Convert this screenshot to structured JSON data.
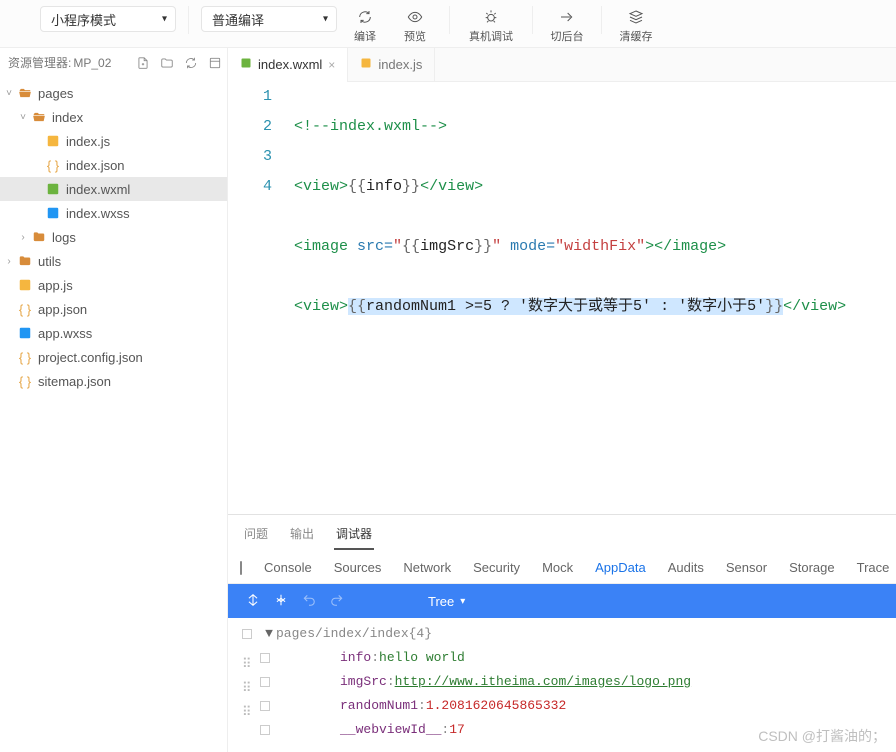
{
  "toolbar": {
    "mode_select": "小程序模式",
    "compile_select": "普通编译",
    "buttons": {
      "compile": "编译",
      "preview": "预览",
      "remote_debug": "真机调试",
      "cut_background": "切后台",
      "clear_cache": "清缓存"
    }
  },
  "sidebar": {
    "title_prefix": "资源管理器: ",
    "project_name": "MP_02",
    "nodes": {
      "pages": "pages",
      "index_folder": "index",
      "index_js": "index.js",
      "index_json": "index.json",
      "index_wxml": "index.wxml",
      "index_wxss": "index.wxss",
      "logs": "logs",
      "utils": "utils",
      "app_js": "app.js",
      "app_json": "app.json",
      "app_wxss": "app.wxss",
      "project_config": "project.config.json",
      "sitemap": "sitemap.json"
    }
  },
  "tabs": {
    "t0": "index.wxml",
    "t1": "index.js"
  },
  "code": {
    "line_numbers": [
      "1",
      "2",
      "3",
      "4"
    ],
    "l1_comment": "<!--index.wxml-->",
    "l2_open": "<view>",
    "l2_open_brace": "{{",
    "l2_expr": "info",
    "l2_close_brace": "}}",
    "l2_close": "</view>",
    "l3_open_tag": "<image",
    "l3_attr_src": " src=",
    "l3_src_q1": "\"",
    "l3_src_ob": "{{",
    "l3_src_expr": "imgSrc",
    "l3_src_cb": "}}",
    "l3_src_q2": "\"",
    "l3_attr_mode": " mode=",
    "l3_mode_val": "\"widthFix\"",
    "l3_close1": ">",
    "l3_close2": "</image>",
    "l4_open": "<view>",
    "l4_ob": "{{",
    "l4_expr": "randomNum1 >=5 ? '数字大于或等于5' : '数字小于5'",
    "l4_cb": "}}",
    "l4_close": "</view>"
  },
  "bottom": {
    "tabs": {
      "problems": "问题",
      "output": "输出",
      "debug": "调试器"
    },
    "devtabs": {
      "console": "Console",
      "sources": "Sources",
      "network": "Network",
      "security": "Security",
      "mock": "Mock",
      "appdata": "AppData",
      "audits": "Audits",
      "sensor": "Sensor",
      "storage": "Storage",
      "trace": "Trace"
    },
    "bluebar": {
      "tree": "Tree"
    },
    "data_tree": {
      "path": "pages/index/index",
      "path_suffix": " {4}",
      "info_key": "info",
      "info_val": "hello world",
      "imgsrc_key": "imgSrc",
      "imgsrc_val": "http://www.itheima.com/images/logo.png",
      "random_key": "randomNum1",
      "random_val": "1.2081620645865332",
      "webview_key": "__webviewId__",
      "webview_val": "17",
      "colon": " : "
    }
  },
  "watermark": "CSDN @打酱油的；"
}
